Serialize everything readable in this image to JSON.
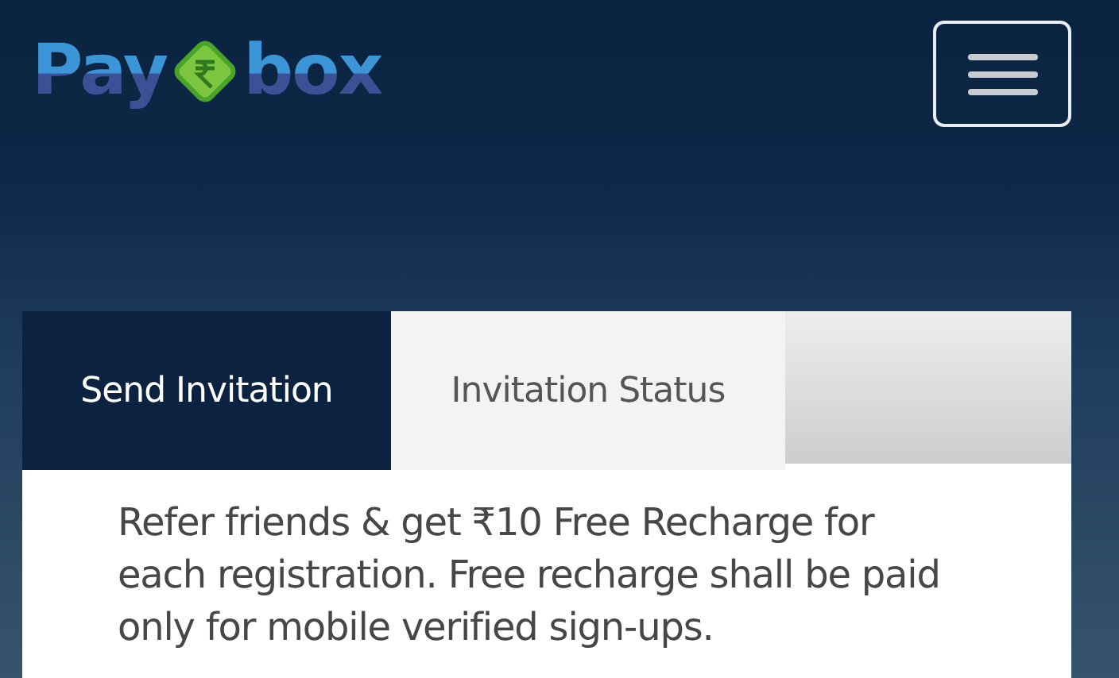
{
  "header": {
    "logo": {
      "text_before": "Pay",
      "text_after": "box"
    }
  },
  "tabs": [
    {
      "label": "Send Invitation",
      "selected": true
    },
    {
      "label": "Invitation Status",
      "selected": false
    }
  ],
  "description": "Refer friends & get ₹10 Free Recharge for each registration. Free recharge shall be paid only for mobile verified sign-ups."
}
